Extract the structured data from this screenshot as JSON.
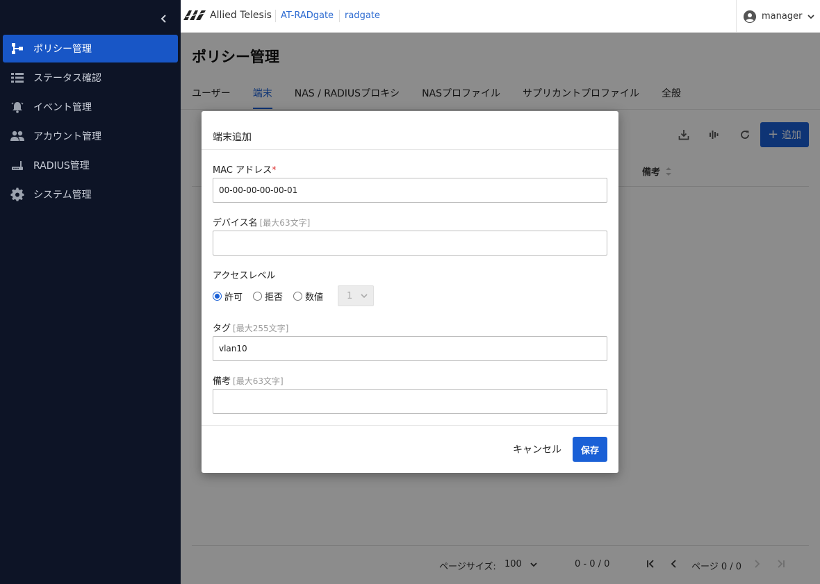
{
  "sidebar": {
    "collapse_icon": "chevron-left-icon",
    "items": [
      {
        "label": "ポリシー管理",
        "icon": "policy-tree-icon",
        "active": true
      },
      {
        "label": "ステータス確認",
        "icon": "list-icon",
        "active": false
      },
      {
        "label": "イベント管理",
        "icon": "alarm-bell-icon",
        "active": false
      },
      {
        "label": "アカウント管理",
        "icon": "people-icon",
        "active": false
      },
      {
        "label": "RADIUS管理",
        "icon": "router-icon",
        "active": false
      },
      {
        "label": "システム管理",
        "icon": "gear-icon",
        "active": false
      }
    ],
    "bg_color": "#0d1426",
    "active_color": "#1856c6"
  },
  "header": {
    "logo_text": "Allied Telesis",
    "breadcrumbs": [
      "AT-RADgate",
      "radgate"
    ],
    "user": "manager"
  },
  "page": {
    "title": "ポリシー管理",
    "tabs": [
      {
        "label": "ユーザー",
        "active": false
      },
      {
        "label": "端末",
        "active": true
      },
      {
        "label": "NAS / RADIUSプロキシ",
        "active": false
      },
      {
        "label": "NASプロファイル",
        "active": false
      },
      {
        "label": "サプリカントプロファイル",
        "active": false
      },
      {
        "label": "全般",
        "active": false
      }
    ],
    "add_label": "追加",
    "column_header": "備考",
    "pager": {
      "page_size_label": "ページサイズ:",
      "page_size": "100",
      "range": "0 - 0 / 0",
      "page_text": "ページ 0 / 0"
    },
    "accent_color": "#1a60d6"
  },
  "modal": {
    "title": "端末追加",
    "mac": {
      "label": "MAC アドレス",
      "required_mark": "*",
      "value": "00-00-00-00-00-01"
    },
    "device_name": {
      "label": "デバイス名",
      "hint": "[最大63文字]",
      "value": ""
    },
    "access_level": {
      "label": "アクセスレベル",
      "options": [
        {
          "label": "許可",
          "checked": true
        },
        {
          "label": "拒否",
          "checked": false
        },
        {
          "label": "数値",
          "checked": false
        }
      ],
      "numeric_value": "1"
    },
    "tag": {
      "label": "タグ",
      "hint": "[最大255文字]",
      "value": "vlan10"
    },
    "remarks": {
      "label": "備考",
      "hint": "[最大63文字]",
      "value": ""
    },
    "cancel_label": "キャンセル",
    "save_label": "保存"
  }
}
